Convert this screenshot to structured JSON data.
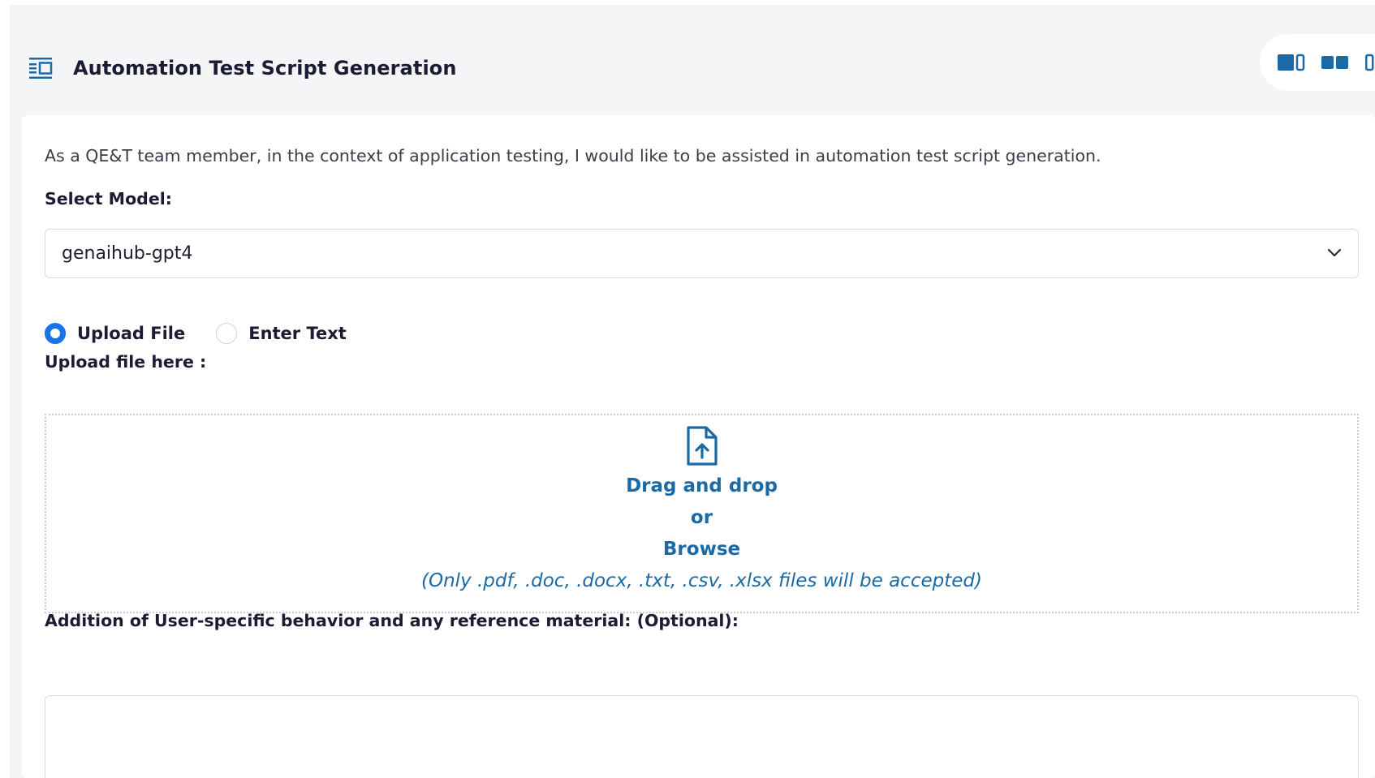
{
  "header": {
    "title": "Automation Test Script Generation",
    "menu_icon": "list-panel-icon"
  },
  "layout_toggles": [
    {
      "icon": "layout-left-wide-icon"
    },
    {
      "icon": "layout-equal-split-icon"
    },
    {
      "icon": "layout-right-wide-icon"
    }
  ],
  "main": {
    "description": "As a QE&T team member, in the context of application testing, I would like to be assisted in automation test script generation.",
    "model_select": {
      "label": "Select Model:",
      "value": "genaihub-gpt4"
    },
    "input_mode": {
      "options": [
        "Upload File",
        "Enter Text"
      ],
      "selected": "Upload File"
    },
    "upload": {
      "label": "Upload file here :",
      "drag_text": "Drag and drop",
      "or_text": "or",
      "browse_text": "Browse",
      "hint": "(Only .pdf, .doc, .docx, .txt, .csv, .xlsx files will be accepted)",
      "icon": "file-upload-icon"
    },
    "additional": {
      "label": "Addition of User-specific behavior and any reference material: (Optional):",
      "value": ""
    }
  },
  "colors": {
    "accent": "#1a73e8",
    "brand": "#1a6aa5",
    "page_bg": "#f4f5f7"
  }
}
